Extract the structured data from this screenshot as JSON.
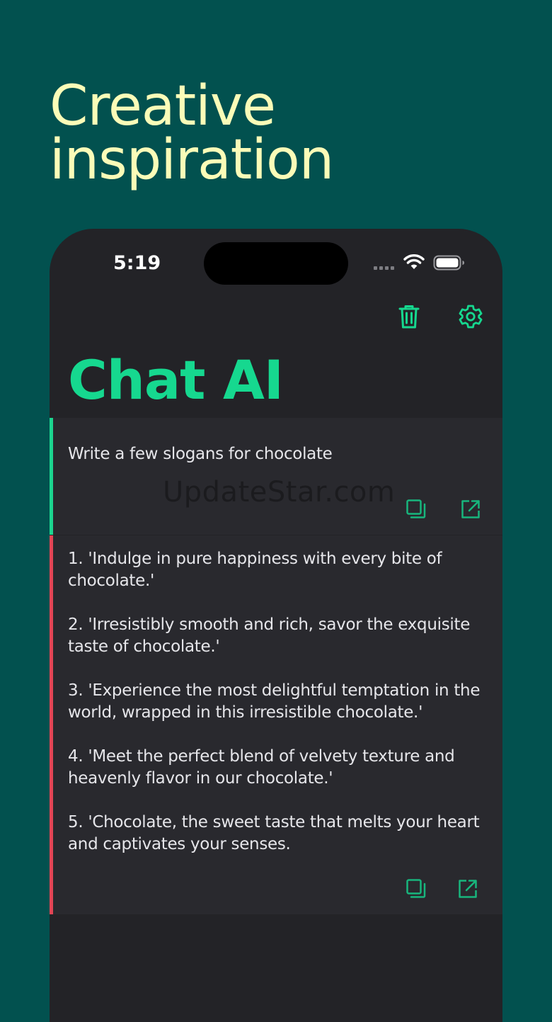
{
  "headline": {
    "line1": "Creative",
    "line2": "inspiration"
  },
  "status_bar": {
    "time": "5:19"
  },
  "app": {
    "title": "Chat AI"
  },
  "prompt": {
    "text": "Write a few slogans for chocolate"
  },
  "response": {
    "slogans": [
      "1. 'Indulge in pure happiness with every bite of chocolate.'",
      "2. 'Irresistibly smooth and rich, savor the exquisite taste of chocolate.'",
      "3. 'Experience the most delightful temptation in the world, wrapped in this irresistible chocolate.'",
      "4. 'Meet the perfect blend of velvety texture and heavenly flavor in our chocolate.'",
      "5. 'Chocolate, the sweet taste that melts your heart and captivates your senses."
    ]
  },
  "watermark": "UpdateStar.com",
  "icons": {
    "toolbar": [
      "trash-icon",
      "gear-icon"
    ],
    "message_actions": [
      "copy-icon",
      "share-icon"
    ]
  },
  "colors": {
    "background": "#02514f",
    "headline": "#fbfcb8",
    "accent_green": "#16d88f",
    "prompt_border": "#1cd58f",
    "response_border": "#e24555",
    "panel": "#29292e",
    "screen": "#232327"
  }
}
